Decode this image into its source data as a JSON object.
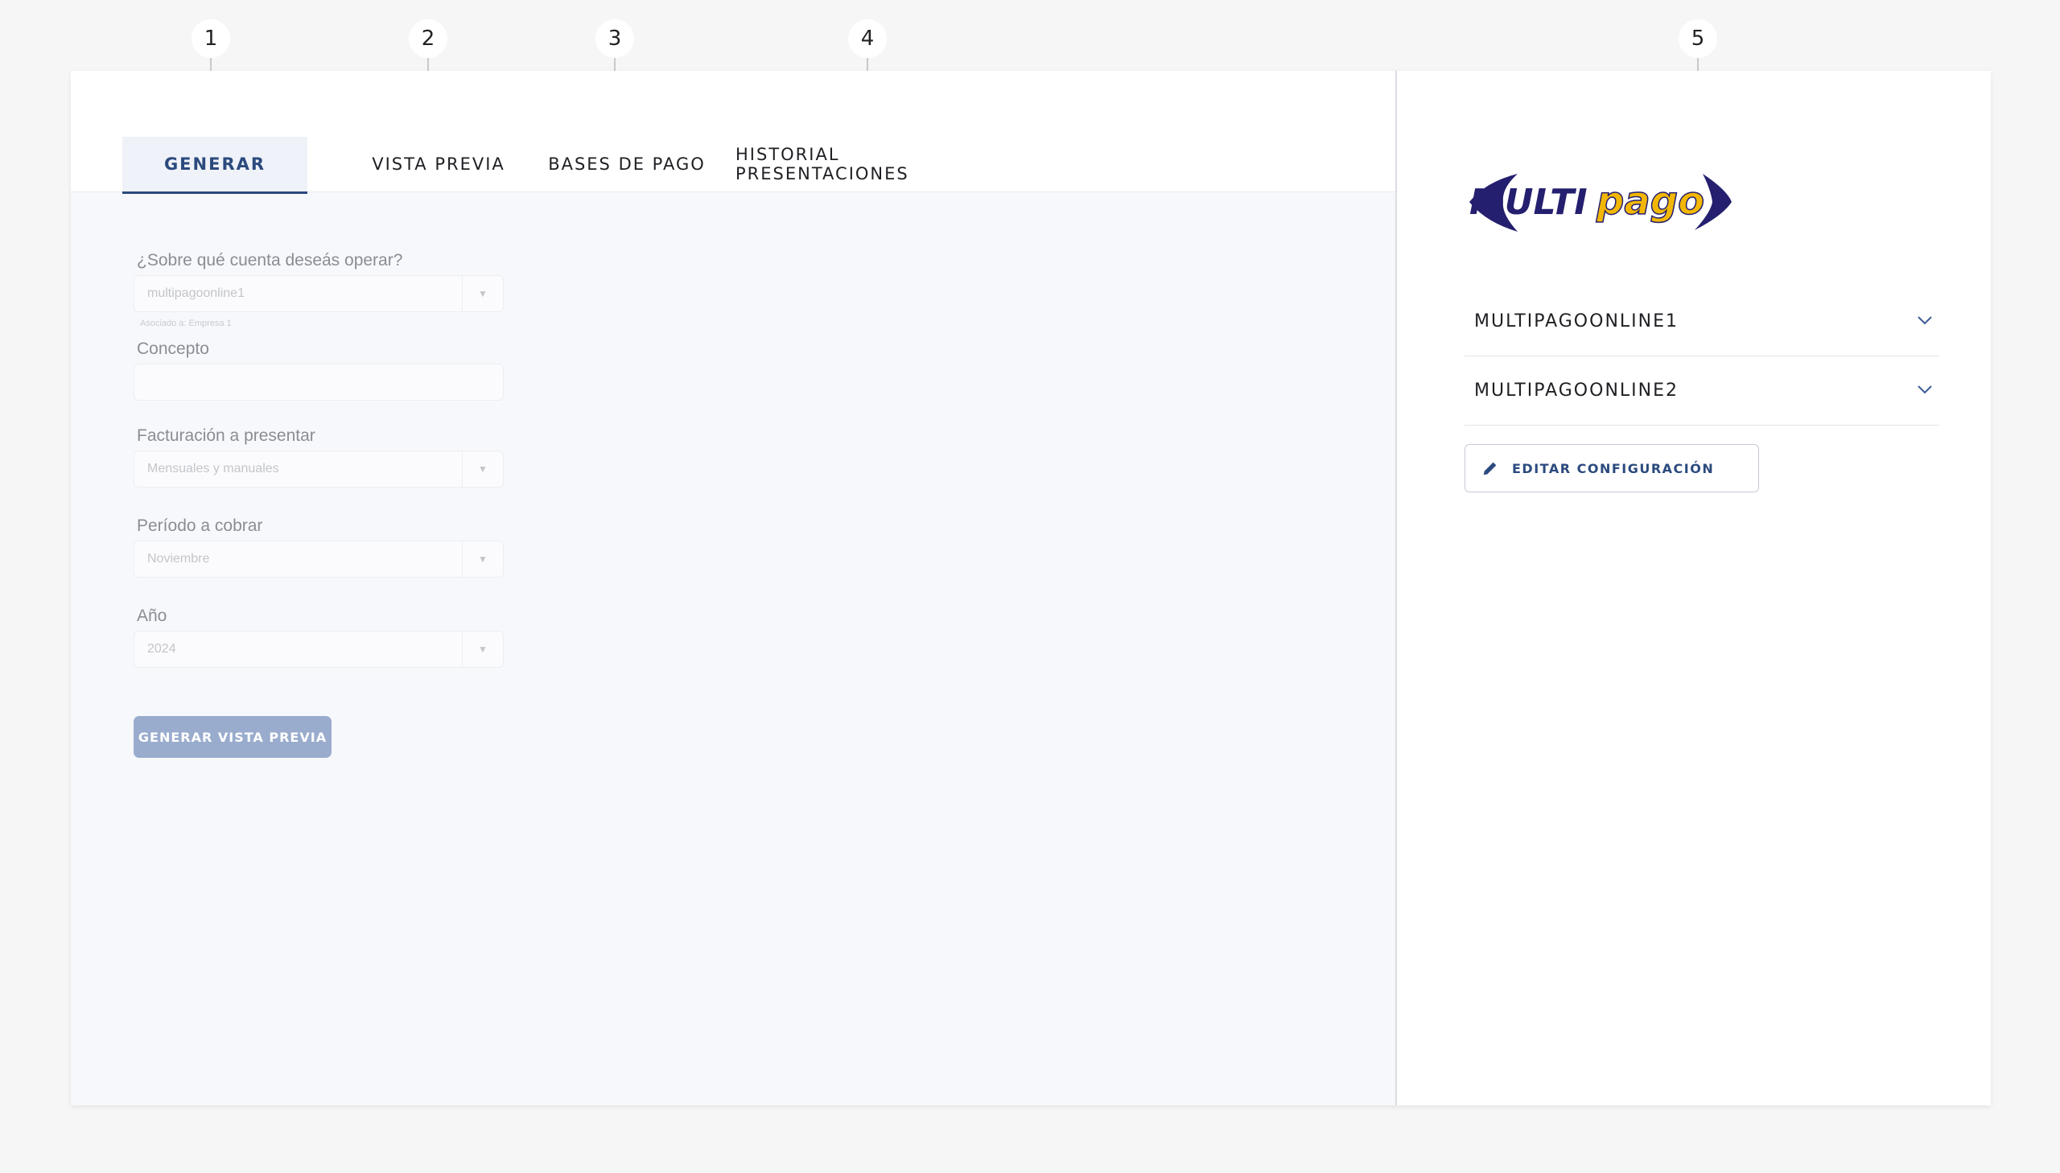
{
  "callouts": [
    "1",
    "2",
    "3",
    "4",
    "5"
  ],
  "tabs": [
    {
      "label": "GENERAR",
      "active": true
    },
    {
      "label": "VISTA PREVIA",
      "active": false
    },
    {
      "label": "BASES DE PAGO",
      "active": false
    },
    {
      "label": "HISTORIAL PRESENTACIONES",
      "active": false
    }
  ],
  "form": {
    "account": {
      "label": "¿Sobre qué cuenta deseás operar?",
      "value": "multipagoonline1",
      "hint": "Asociado a: Empresa 1"
    },
    "concept": {
      "label": "Concepto",
      "value": ""
    },
    "billing": {
      "label": "Facturación a presentar",
      "value": "Mensuales y manuales"
    },
    "period": {
      "label": "Período a cobrar",
      "value": "Noviembre"
    },
    "year": {
      "label": "Año",
      "value": "2024"
    },
    "submit_label": "GENERAR VISTA PREVIA"
  },
  "sidebar": {
    "logo_text_left": "MULTI",
    "logo_text_right": "pago",
    "accounts": [
      "MULTIPAGOONLINE1",
      "MULTIPAGOONLINE2"
    ],
    "edit_label": "EDITAR CONFIGURACIÓN"
  },
  "colors": {
    "accent": "#2b4a7e",
    "logo_navy": "#241f6e",
    "logo_gold": "#f2b705",
    "button_disabled": "#9aaccd"
  }
}
